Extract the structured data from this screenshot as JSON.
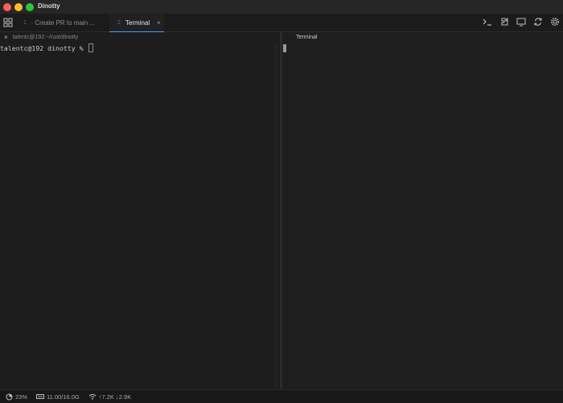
{
  "window": {
    "title": "Dinotty"
  },
  "tabs": [
    {
      "number": "1",
      "label": "∙ Create PR to main ...",
      "active": false
    },
    {
      "number": "2",
      "label": "Terminal",
      "active": true,
      "close": "×"
    }
  ],
  "toolbar": {
    "icons": [
      "terminal-prompt-icon",
      "extensions-icon",
      "display-icon",
      "refresh-icon",
      "gear-icon"
    ]
  },
  "left_pane": {
    "close": "×",
    "title": "talentc@192:~/rust/dinotty",
    "prompt": "talentc@192 dinotty % "
  },
  "right_pane": {
    "title": "Terminal"
  },
  "status": {
    "cpu": "23%",
    "memory": "11.00/16.0G",
    "network": "↑7.2K ↓2.9K"
  },
  "colors": {
    "accent": "#4a9eff",
    "close": "#ff5f57",
    "minimize": "#febc2e",
    "maximize": "#28c840"
  }
}
